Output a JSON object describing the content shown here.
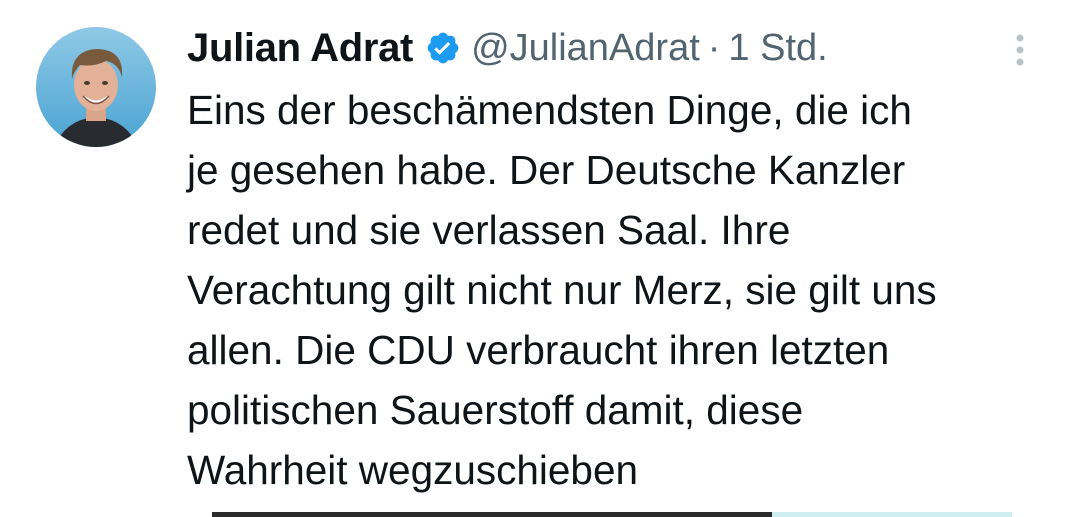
{
  "tweet": {
    "author": {
      "display_name": "Julian Adrat",
      "handle": "@JulianAdrat",
      "verified": true,
      "avatar_icon": "user-photo-avatar"
    },
    "separator": "·",
    "timestamp": "1 Std.",
    "more_icon": "vertical-ellipsis-icon",
    "text": "Eins der beschämendsten Dinge, die ich\nje gesehen habe. Der Deutsche Kanzler\nredet und sie verlassen Saal. Ihre\nVerachtung gilt nicht nur Merz, sie gilt uns\nallen. Die CDU verbraucht ihren letzten\npolitischen Sauerstoff damit, diese\nWahrheit wegzuschieben"
  },
  "colors": {
    "primary_text": "#0f1419",
    "secondary_text": "#536471",
    "verified_blue": "#1d9bf0",
    "background": "#ffffff"
  }
}
